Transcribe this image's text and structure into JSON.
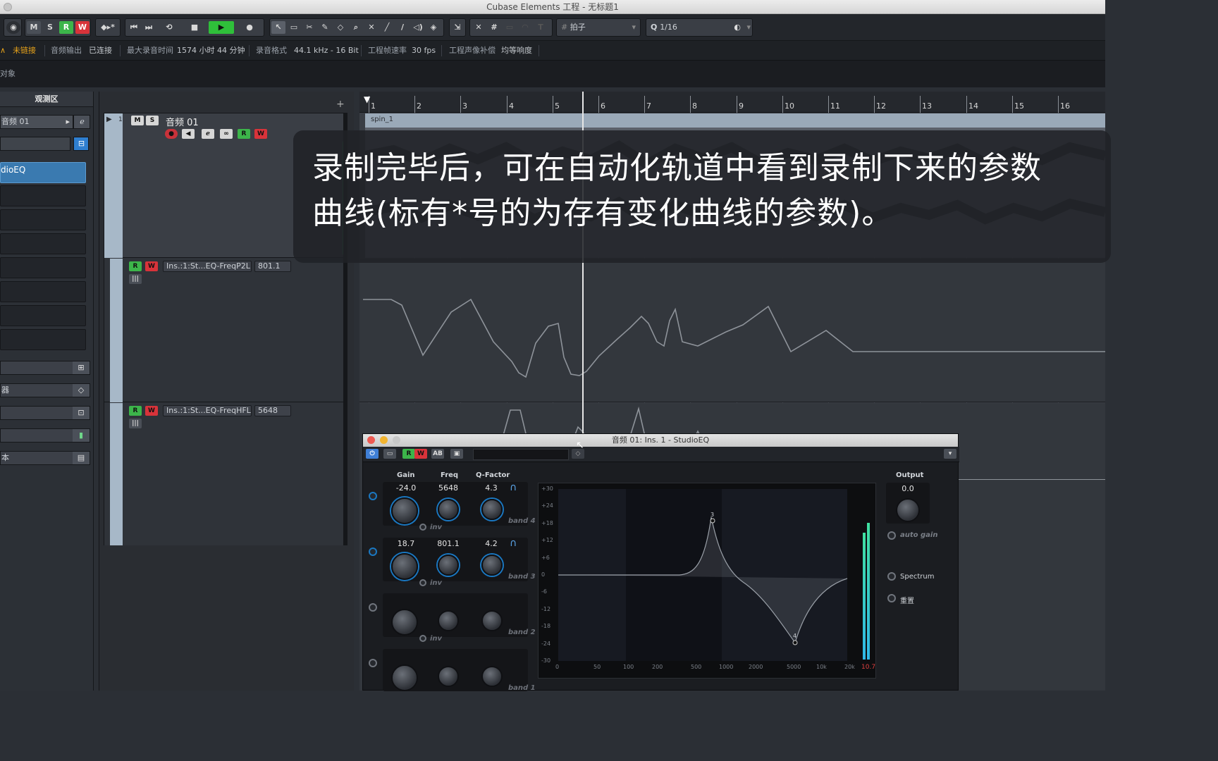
{
  "window": {
    "title": "Cubase Elements 工程 - 无标题1"
  },
  "toolbar": {
    "m_label": "M",
    "s_label": "S",
    "r_label": "R",
    "w_label": "W",
    "grid_type": "拍子",
    "quantize": "1/16",
    "colors": {
      "record": "#3cb54a",
      "write": "#d8333a",
      "play": "#2fbf3a"
    }
  },
  "infobar": {
    "link_status": "未链接",
    "audio_out_label": "音频输出",
    "audio_out_value": "已连接",
    "max_rec_label": "最大录音时间",
    "max_rec_value": "1574 小时 44 分钟",
    "rec_format_label": "录音格式",
    "rec_format_value": "44.1 kHz - 16 Bit",
    "frame_rate_label": "工程帧速率",
    "frame_rate_value": "30 fps",
    "pan_law_label": "工程声像补偿",
    "pan_law_value": "均等响度"
  },
  "objbar": {
    "label": "对象"
  },
  "inspector": {
    "title": "观测区",
    "track_name": "音频 01",
    "insert_slot": "dioEQ",
    "bars": [
      "",
      "器",
      "",
      "",
      "本"
    ]
  },
  "tracks": {
    "audio": {
      "number": "1",
      "name": "音频 01",
      "m": "M",
      "s": "S",
      "r": "R",
      "w": "W"
    },
    "auto1": {
      "r": "R",
      "w": "W",
      "param": "Ins.:1:St...EQ-FreqP2L",
      "value": "801.1"
    },
    "auto2": {
      "r": "R",
      "w": "W",
      "param": "Ins.:1:St...EQ-FreqHFL",
      "value": "5648"
    }
  },
  "ruler": {
    "bars": [
      "1",
      "2",
      "3",
      "4",
      "5",
      "6",
      "7",
      "8",
      "9",
      "10",
      "11",
      "12",
      "13",
      "14",
      "15",
      "16"
    ]
  },
  "clip": {
    "name": "spin_1"
  },
  "caption": {
    "line1": "录制完毕后，可在自动化轨道中看到录制下来的参数",
    "line2": "曲线(标有*号的为存有变化曲线的参数)。"
  },
  "eq": {
    "title": "音频 01: Ins. 1 - StudioEQ",
    "labels": {
      "gain": "Gain",
      "freq": "Freq",
      "q": "Q-Factor",
      "output": "Output",
      "inv": "inv",
      "auto_gain": "auto gain",
      "spectrum": "Spectrum",
      "reset": "重置"
    },
    "bands": [
      {
        "name": "band 4",
        "gain": "-24.0",
        "freq": "5648",
        "q": "4.3"
      },
      {
        "name": "band 3",
        "gain": "18.7",
        "freq": "801.1",
        "q": "4.2"
      },
      {
        "name": "band 2",
        "gain": "",
        "freq": "",
        "q": ""
      },
      {
        "name": "band 1",
        "gain": "",
        "freq": "",
        "q": ""
      }
    ],
    "output_value": "0.0",
    "meter_value": "10.7",
    "db_labels": [
      "+30",
      "+24",
      "+18",
      "+12",
      "+6",
      "0",
      "-6",
      "-12",
      "-18",
      "-24",
      "-30"
    ],
    "freq_labels": [
      "0",
      "50",
      "100",
      "200",
      "500",
      "1000",
      "2000",
      "5000",
      "10k",
      "20k"
    ],
    "node_labels": [
      "3",
      "4"
    ]
  }
}
